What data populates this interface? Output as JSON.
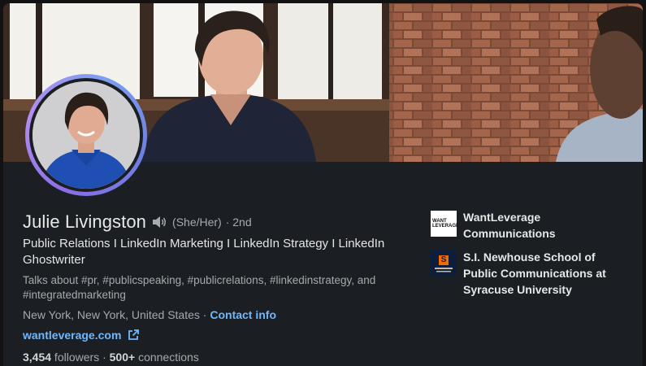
{
  "profile": {
    "name": "Julie Livingston",
    "pronouns": "(She/Her)",
    "degree": "· 2nd",
    "headline": "Public Relations I LinkedIn Marketing I LinkedIn Strategy I LinkedIn Ghostwriter",
    "talks_about": "Talks about #pr, #publicspeaking, #publicrelations, #linkedinstrategy, and #integratedmarketing",
    "location": "New York, New York, United States",
    "separator": " · ",
    "contact_info": "Contact info",
    "website": "wantleverage.com",
    "followers_count": "3,454",
    "followers_label": " followers",
    "dot": " · ",
    "connections_count": "500+",
    "connections_label": " connections"
  },
  "organizations": [
    {
      "name": "WantLeverage Communications",
      "logo_text_1": "WANT",
      "logo_text_2": "LEVERAGE"
    },
    {
      "name": "S.I. Newhouse School of Public Communications at Syracuse University",
      "logo_mark": "S"
    }
  ],
  "colors": {
    "accent_link": "#71b7fb",
    "card_bg": "#1b1f23",
    "ring_start": "#8a6ee8",
    "ring_end": "#7a9ff0"
  },
  "icons": [
    "speaker-icon",
    "external-link-icon"
  ]
}
